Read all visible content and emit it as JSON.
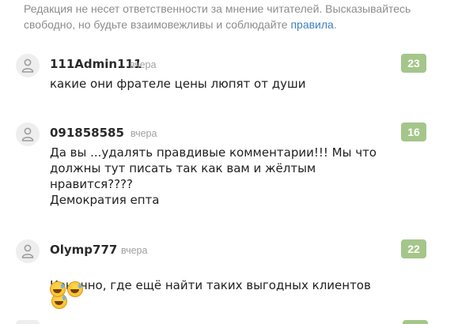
{
  "notice": {
    "text": "Редакция не несет ответственности за мнение читателей. Высказывайтесь свободно, но будьте взаимовежливы и соблюдайте ",
    "link": "правила",
    "end": "."
  },
  "comments": [
    {
      "author": "111Admin111",
      "time": "вчера",
      "rating": "23",
      "text": "какие они фрателе цены люпят от души"
    },
    {
      "author": "091858585",
      "time": "вчера",
      "rating": "16",
      "text": "Да вы ...удалять правдивые комментарии!!! Мы что\nдолжны тут писать так как вам и жёлтым\nнравится????\nДемократия епта"
    },
    {
      "author": "Olymp777",
      "time": "вчера",
      "rating": "22",
      "text": "Конечно, где ещё найти таких выгодных клиентов",
      "emoji": "grinning-face-with-sweat-icon"
    }
  ],
  "colors": {
    "rating_bg": "#a4c68a",
    "link": "#3f7fbf",
    "muted": "#8c8c8c"
  }
}
